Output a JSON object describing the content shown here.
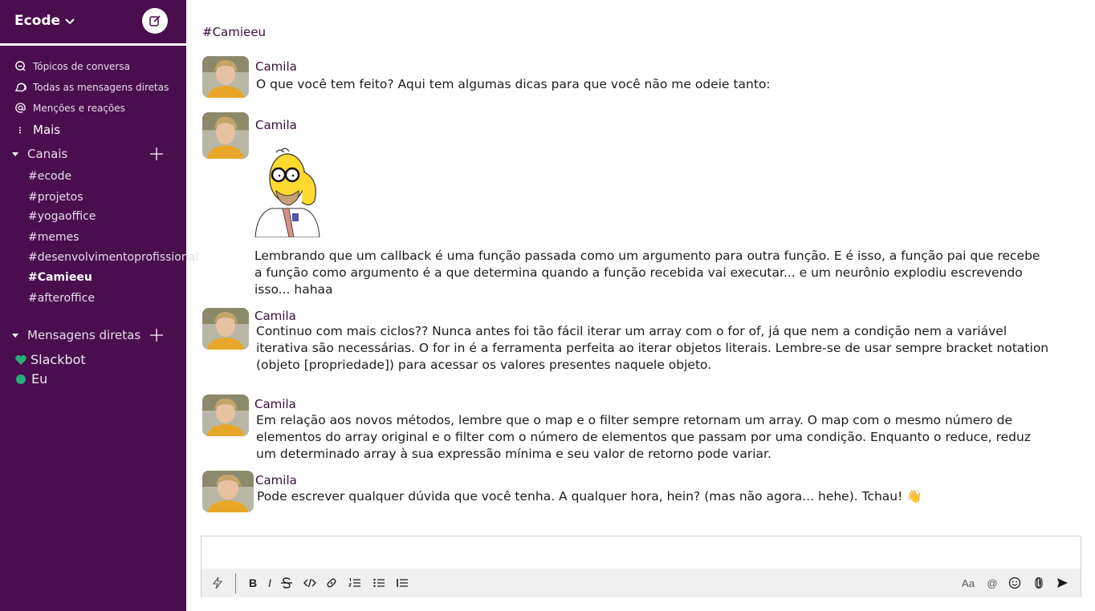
{
  "workspace": {
    "name": "Ecode"
  },
  "nav": [
    {
      "label": "Tópicos de conversa",
      "icon": "threads-icon"
    },
    {
      "label": "Todas as mensagens diretas",
      "icon": "dms-icon"
    },
    {
      "label": "Menções e reações",
      "icon": "at-icon"
    }
  ],
  "more": {
    "label": "Mais",
    "icon": "more-vertical-icon"
  },
  "channels_section": {
    "title": "Canais",
    "items": [
      "#ecode",
      "#projetos",
      "#yogaoffice",
      "#memes",
      "#desenvolvimentoprofissional",
      "#Camieeu",
      "#afteroffice"
    ],
    "active": "#Camieeu"
  },
  "dm_section": {
    "title": "Mensagens diretas",
    "items": [
      {
        "label": "Slackbot",
        "icon": "heart-icon"
      },
      {
        "label": "Eu",
        "icon": "presence-dot-icon"
      }
    ]
  },
  "channel": {
    "title": "#Camieeu"
  },
  "messages": [
    {
      "author": "Camila",
      "text": "O que você tem feito? Aqui tem algumas dicas para que você não me odeie tanto:"
    },
    {
      "author": "Camila",
      "text": "Lembrando que um callback é uma função passada como um argumento para outra função. E é isso, a função pai que recebe a função como argumento é a que determina quando a função recebida vai executar... e um neurônio explodiu escrevendo isso... hahaa",
      "sticker": "homer-thinking-sticker"
    },
    {
      "author": "Camila",
      "text": "Continuo com mais ciclos?? Nunca antes foi tão fácil iterar um array com o for of, já que nem a condição nem a variável iterativa são necessárias. O for in é a ferramenta perfeita ao iterar objetos literais. Lembre-se de usar sempre bracket notation (objeto [propriedade]) para acessar os valores presentes naquele objeto."
    },
    {
      "author": "Camila",
      "text": "Em relação aos novos métodos, lembre que o map e o filter sempre retornam um array. O map com o mesmo número de elementos do array original e o filter com o número de elementos que passam por uma condição. Enquanto o reduce, reduz um determinado array à sua expressão mínima e seu valor de retorno pode variar."
    },
    {
      "author": "Camila",
      "text": "Pode escrever qualquer dúvida que você tenha. A qualquer hora, hein? (mas não agora... hehe). Tchau! 👋"
    }
  ],
  "composer": {
    "value": "",
    "toolbar": {
      "shortcuts_icon": "lightning-icon",
      "bold": "B",
      "italic": "I",
      "format_toggle": "Aa",
      "mention": "@"
    }
  },
  "colors": {
    "sidebar": "#4a0e4e",
    "accent": "#3c0a40",
    "presence": "#2bac76"
  }
}
